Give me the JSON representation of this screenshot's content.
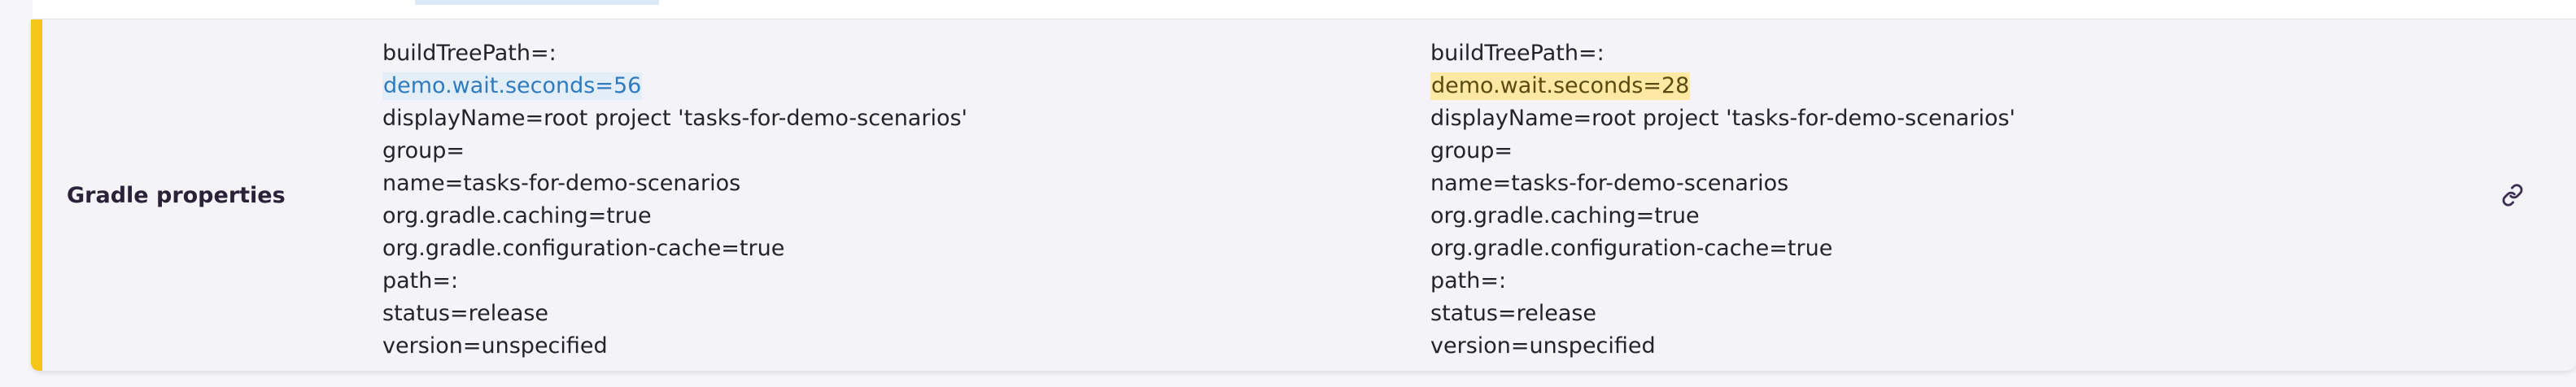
{
  "row": {
    "label": "Gradle properties"
  },
  "left": {
    "lines": [
      "buildTreePath=:",
      "demo.wait.seconds=56",
      "displayName=root project 'tasks-for-demo-scenarios'",
      "group=",
      "name=tasks-for-demo-scenarios",
      "org.gradle.caching=true",
      "org.gradle.configuration-cache=true",
      "path=:",
      "status=release",
      "version=unspecified"
    ]
  },
  "right": {
    "lines": [
      "buildTreePath=:",
      "demo.wait.seconds=28",
      "displayName=root project 'tasks-for-demo-scenarios'",
      "group=",
      "name=tasks-for-demo-scenarios",
      "org.gradle.caching=true",
      "org.gradle.configuration-cache=true",
      "path=:",
      "status=release",
      "version=unspecified"
    ]
  },
  "icons": {
    "link": "link-icon"
  },
  "colors": {
    "accent": "#f5c518",
    "left_diff_bg": "#e3eef9",
    "left_diff_text": "#2f7bbf",
    "right_diff_bg": "#fde9a4"
  }
}
